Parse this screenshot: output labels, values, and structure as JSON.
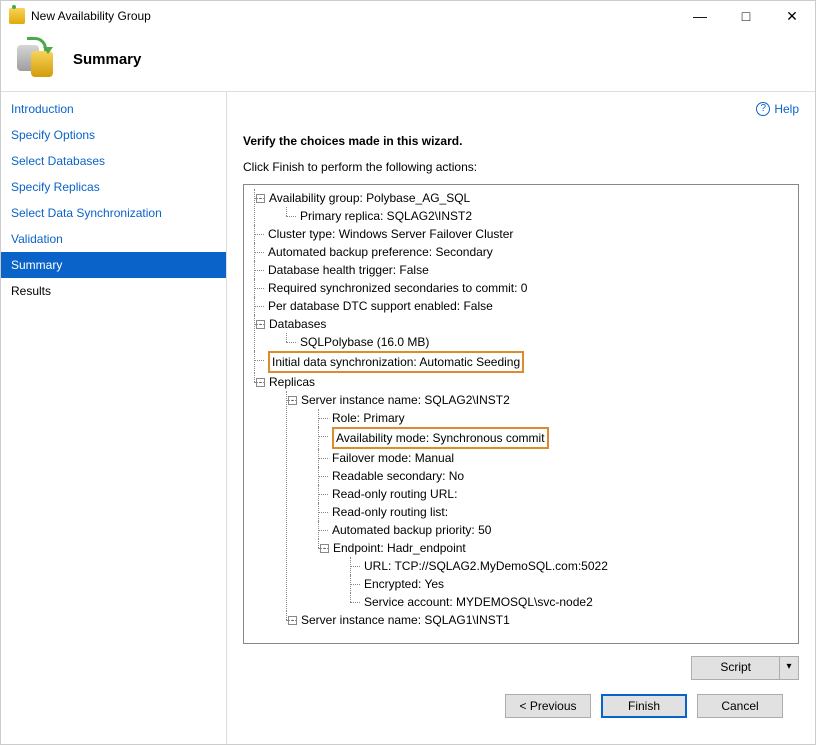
{
  "window": {
    "title": "New Availability Group"
  },
  "header": {
    "title": "Summary"
  },
  "sidebar": {
    "items": [
      {
        "label": "Introduction",
        "selected": false,
        "link": true
      },
      {
        "label": "Specify Options",
        "selected": false,
        "link": true
      },
      {
        "label": "Select Databases",
        "selected": false,
        "link": true
      },
      {
        "label": "Specify Replicas",
        "selected": false,
        "link": true
      },
      {
        "label": "Select Data Synchronization",
        "selected": false,
        "link": true
      },
      {
        "label": "Validation",
        "selected": false,
        "link": true
      },
      {
        "label": "Summary",
        "selected": true,
        "link": true
      },
      {
        "label": "Results",
        "selected": false,
        "link": false
      }
    ]
  },
  "help_label": "Help",
  "main": {
    "heading": "Verify the choices made in this wizard.",
    "subheading": "Click Finish to perform the following actions:"
  },
  "tree": {
    "ag_label": "Availability group: Polybase_AG_SQL",
    "primary_replica": "Primary replica: SQLAG2\\INST2",
    "cluster_type": "Cluster type: Windows Server Failover Cluster",
    "backup_pref": "Automated backup preference: Secondary",
    "db_health": "Database health trigger: False",
    "req_sync": "Required synchronized secondaries to commit: 0",
    "dtc": "Per database DTC support enabled: False",
    "databases_label": "Databases",
    "db1": "SQLPolybase (16.0 MB)",
    "init_sync": "Initial data synchronization: Automatic Seeding",
    "replicas_label": "Replicas",
    "r1_name": "Server instance name: SQLAG2\\INST2",
    "r1_role": "Role: Primary",
    "r1_avail": "Availability mode: Synchronous commit",
    "r1_failover": "Failover mode: Manual",
    "r1_readable": "Readable secondary: No",
    "r1_ro_url": "Read-only routing URL:",
    "r1_ro_list": "Read-only routing list:",
    "r1_backup_prio": "Automated backup priority: 50",
    "r1_endpoint": "Endpoint: Hadr_endpoint",
    "r1_ep_url": "URL: TCP://SQLAG2.MyDemoSQL.com:5022",
    "r1_ep_enc": "Encrypted: Yes",
    "r1_ep_svc": "Service account: MYDEMOSQL\\svc-node2",
    "r2_name": "Server instance name: SQLAG1\\INST1"
  },
  "buttons": {
    "script": "Script",
    "previous": "< Previous",
    "finish": "Finish",
    "cancel": "Cancel"
  }
}
